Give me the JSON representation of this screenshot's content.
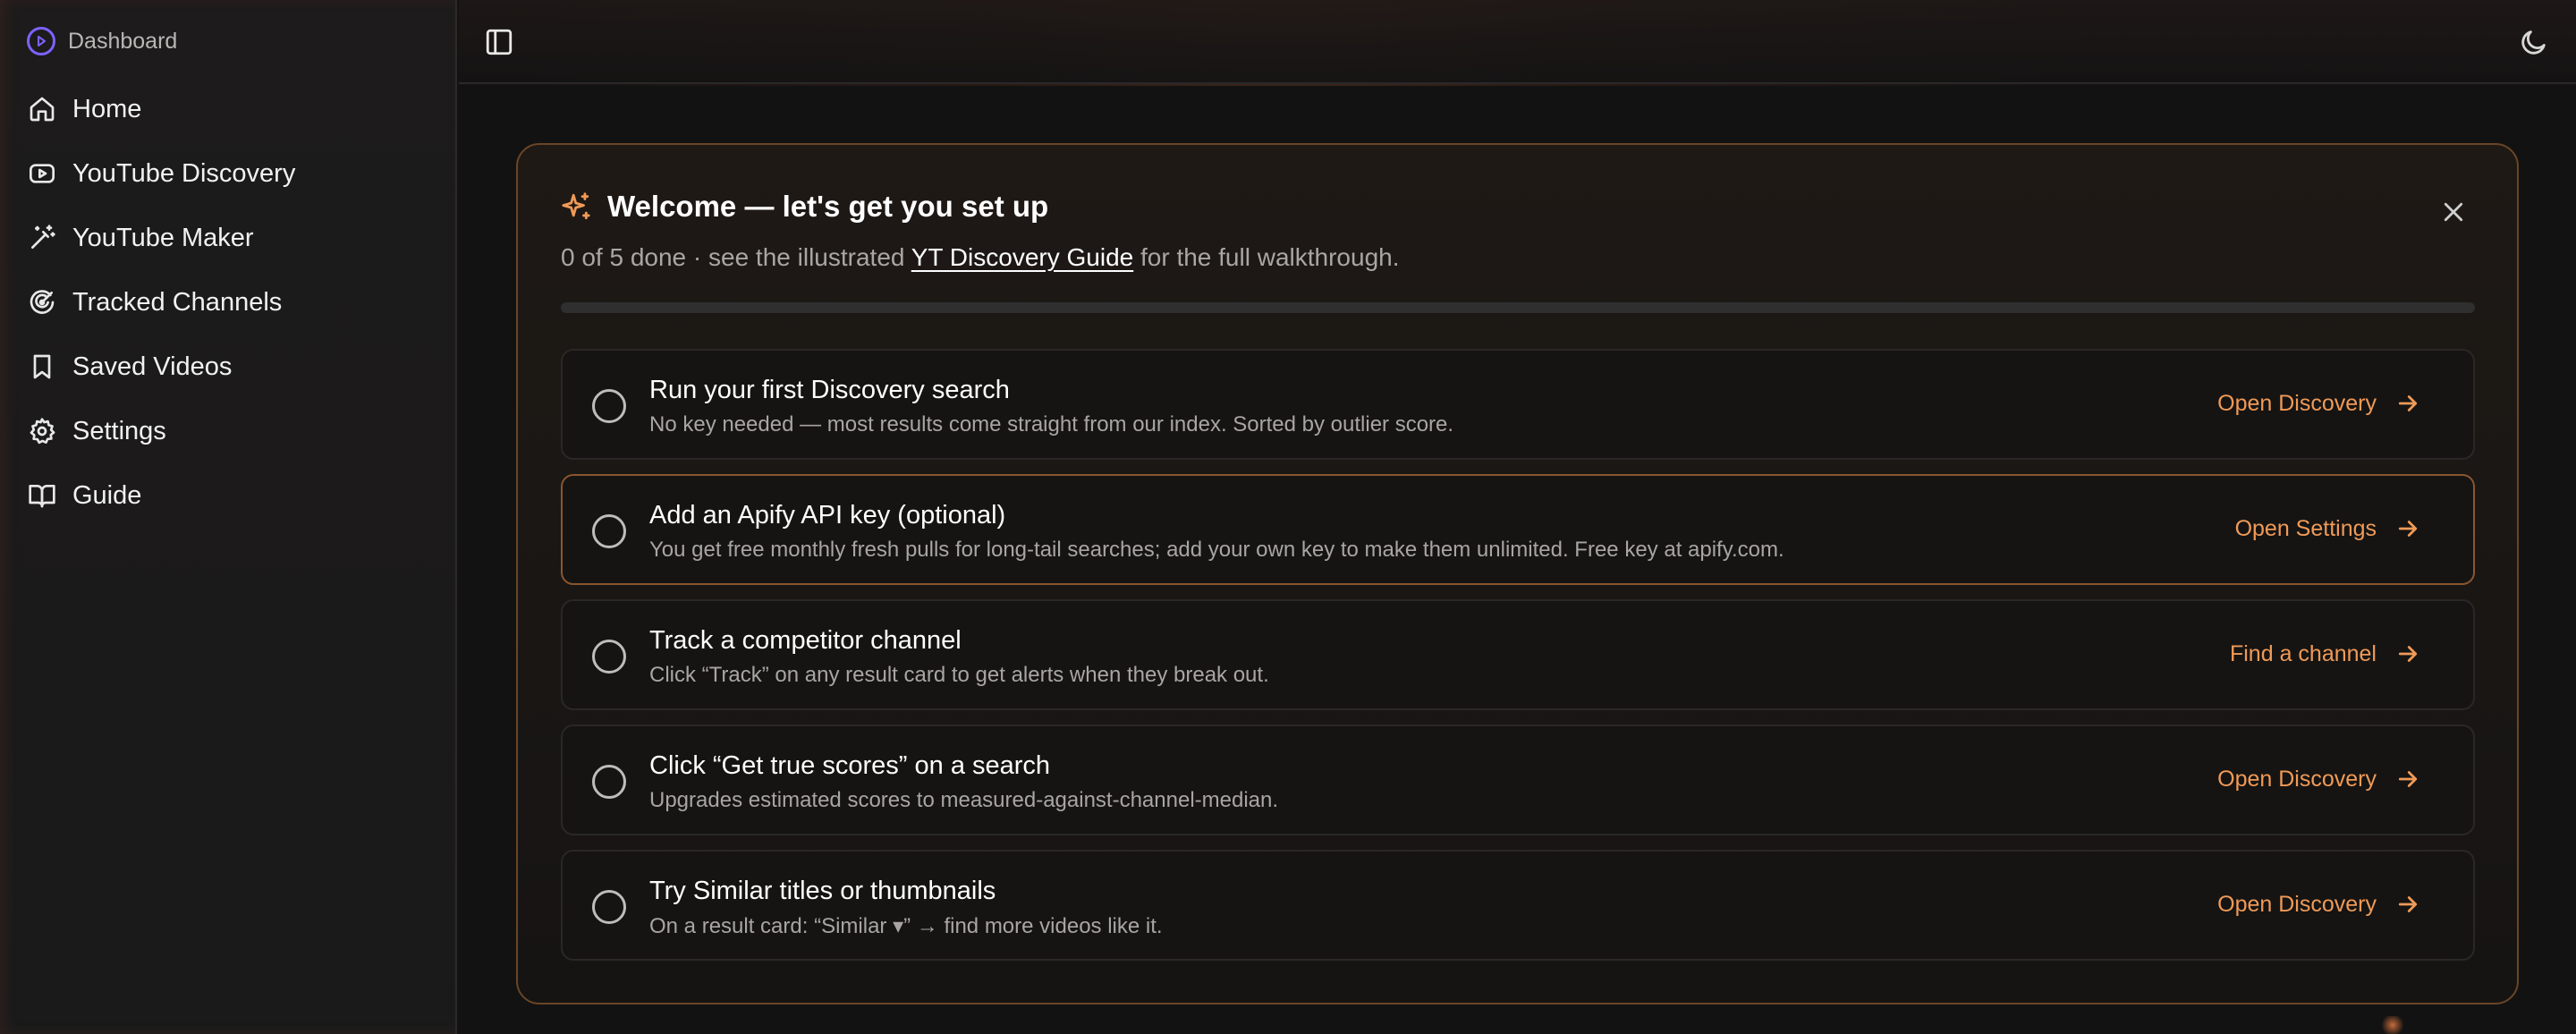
{
  "sidebar": {
    "brand": "Dashboard",
    "items": [
      {
        "label": "Home",
        "icon": "home-icon"
      },
      {
        "label": "YouTube Discovery",
        "icon": "youtube-icon"
      },
      {
        "label": "YouTube Maker",
        "icon": "magic-wand-icon"
      },
      {
        "label": "Tracked Channels",
        "icon": "radar-icon"
      },
      {
        "label": "Saved Videos",
        "icon": "bookmark-icon"
      },
      {
        "label": "Settings",
        "icon": "gear-icon"
      },
      {
        "label": "Guide",
        "icon": "book-icon"
      }
    ]
  },
  "topbar": {
    "left_icon": "sidebar-toggle-icon",
    "right_icon": "moon-icon"
  },
  "onboarding": {
    "title": "Welcome — let's get you set up",
    "progress_text": "0 of 5 done · see the illustrated ",
    "guide_link": "YT Discovery Guide",
    "progress_suffix": " for the full walkthrough.",
    "progress_fraction": 0,
    "tasks": [
      {
        "title": "Run your first Discovery search",
        "description": "No key needed — most results come straight from our index. Sorted by outlier score.",
        "action": "Open Discovery",
        "highlight": false
      },
      {
        "title": "Add an Apify API key (optional)",
        "description": "You get free monthly fresh pulls for long-tail searches; add your own key to make them unlimited. Free key at apify.com.",
        "action": "Open Settings",
        "highlight": true
      },
      {
        "title": "Track a competitor channel",
        "description": "Click “Track” on any result card to get alerts when they break out.",
        "action": "Find a channel",
        "highlight": false
      },
      {
        "title": "Click “Get true scores” on a search",
        "description": "Upgrades estimated scores to measured-against-channel-median.",
        "action": "Open Discovery",
        "highlight": false
      },
      {
        "title": "Try Similar titles or thumbnails",
        "description": "On a result card: “Similar ▾” → find more videos like it.",
        "action": "Open Discovery",
        "highlight": false
      }
    ]
  },
  "colors": {
    "accent": "#f09a57",
    "brand": "#7b63ff",
    "card_border": "#6a4526"
  }
}
